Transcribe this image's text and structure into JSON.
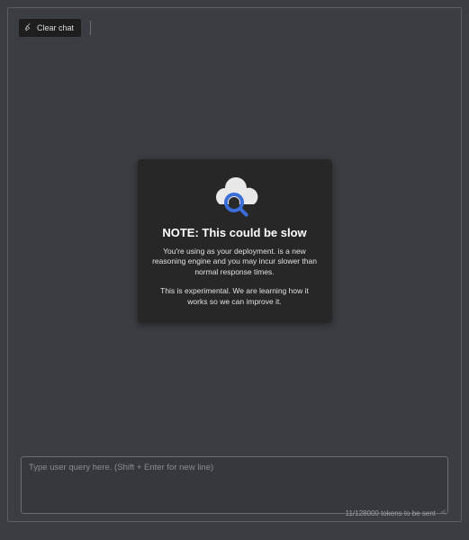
{
  "toolbar": {
    "clear_label": "Clear chat"
  },
  "notice": {
    "title": "NOTE: This could be slow",
    "paragraph1": "You're using as your deployment. is a new reasoning engine and you may incur slower than normal response times.",
    "paragraph2": "This is experimental. We are learning how it works so we can improve it."
  },
  "input": {
    "placeholder": "Type user query here. (Shift + Enter for new line)",
    "value": ""
  },
  "footer": {
    "token_text": "11/128000 tokens to be sent"
  }
}
